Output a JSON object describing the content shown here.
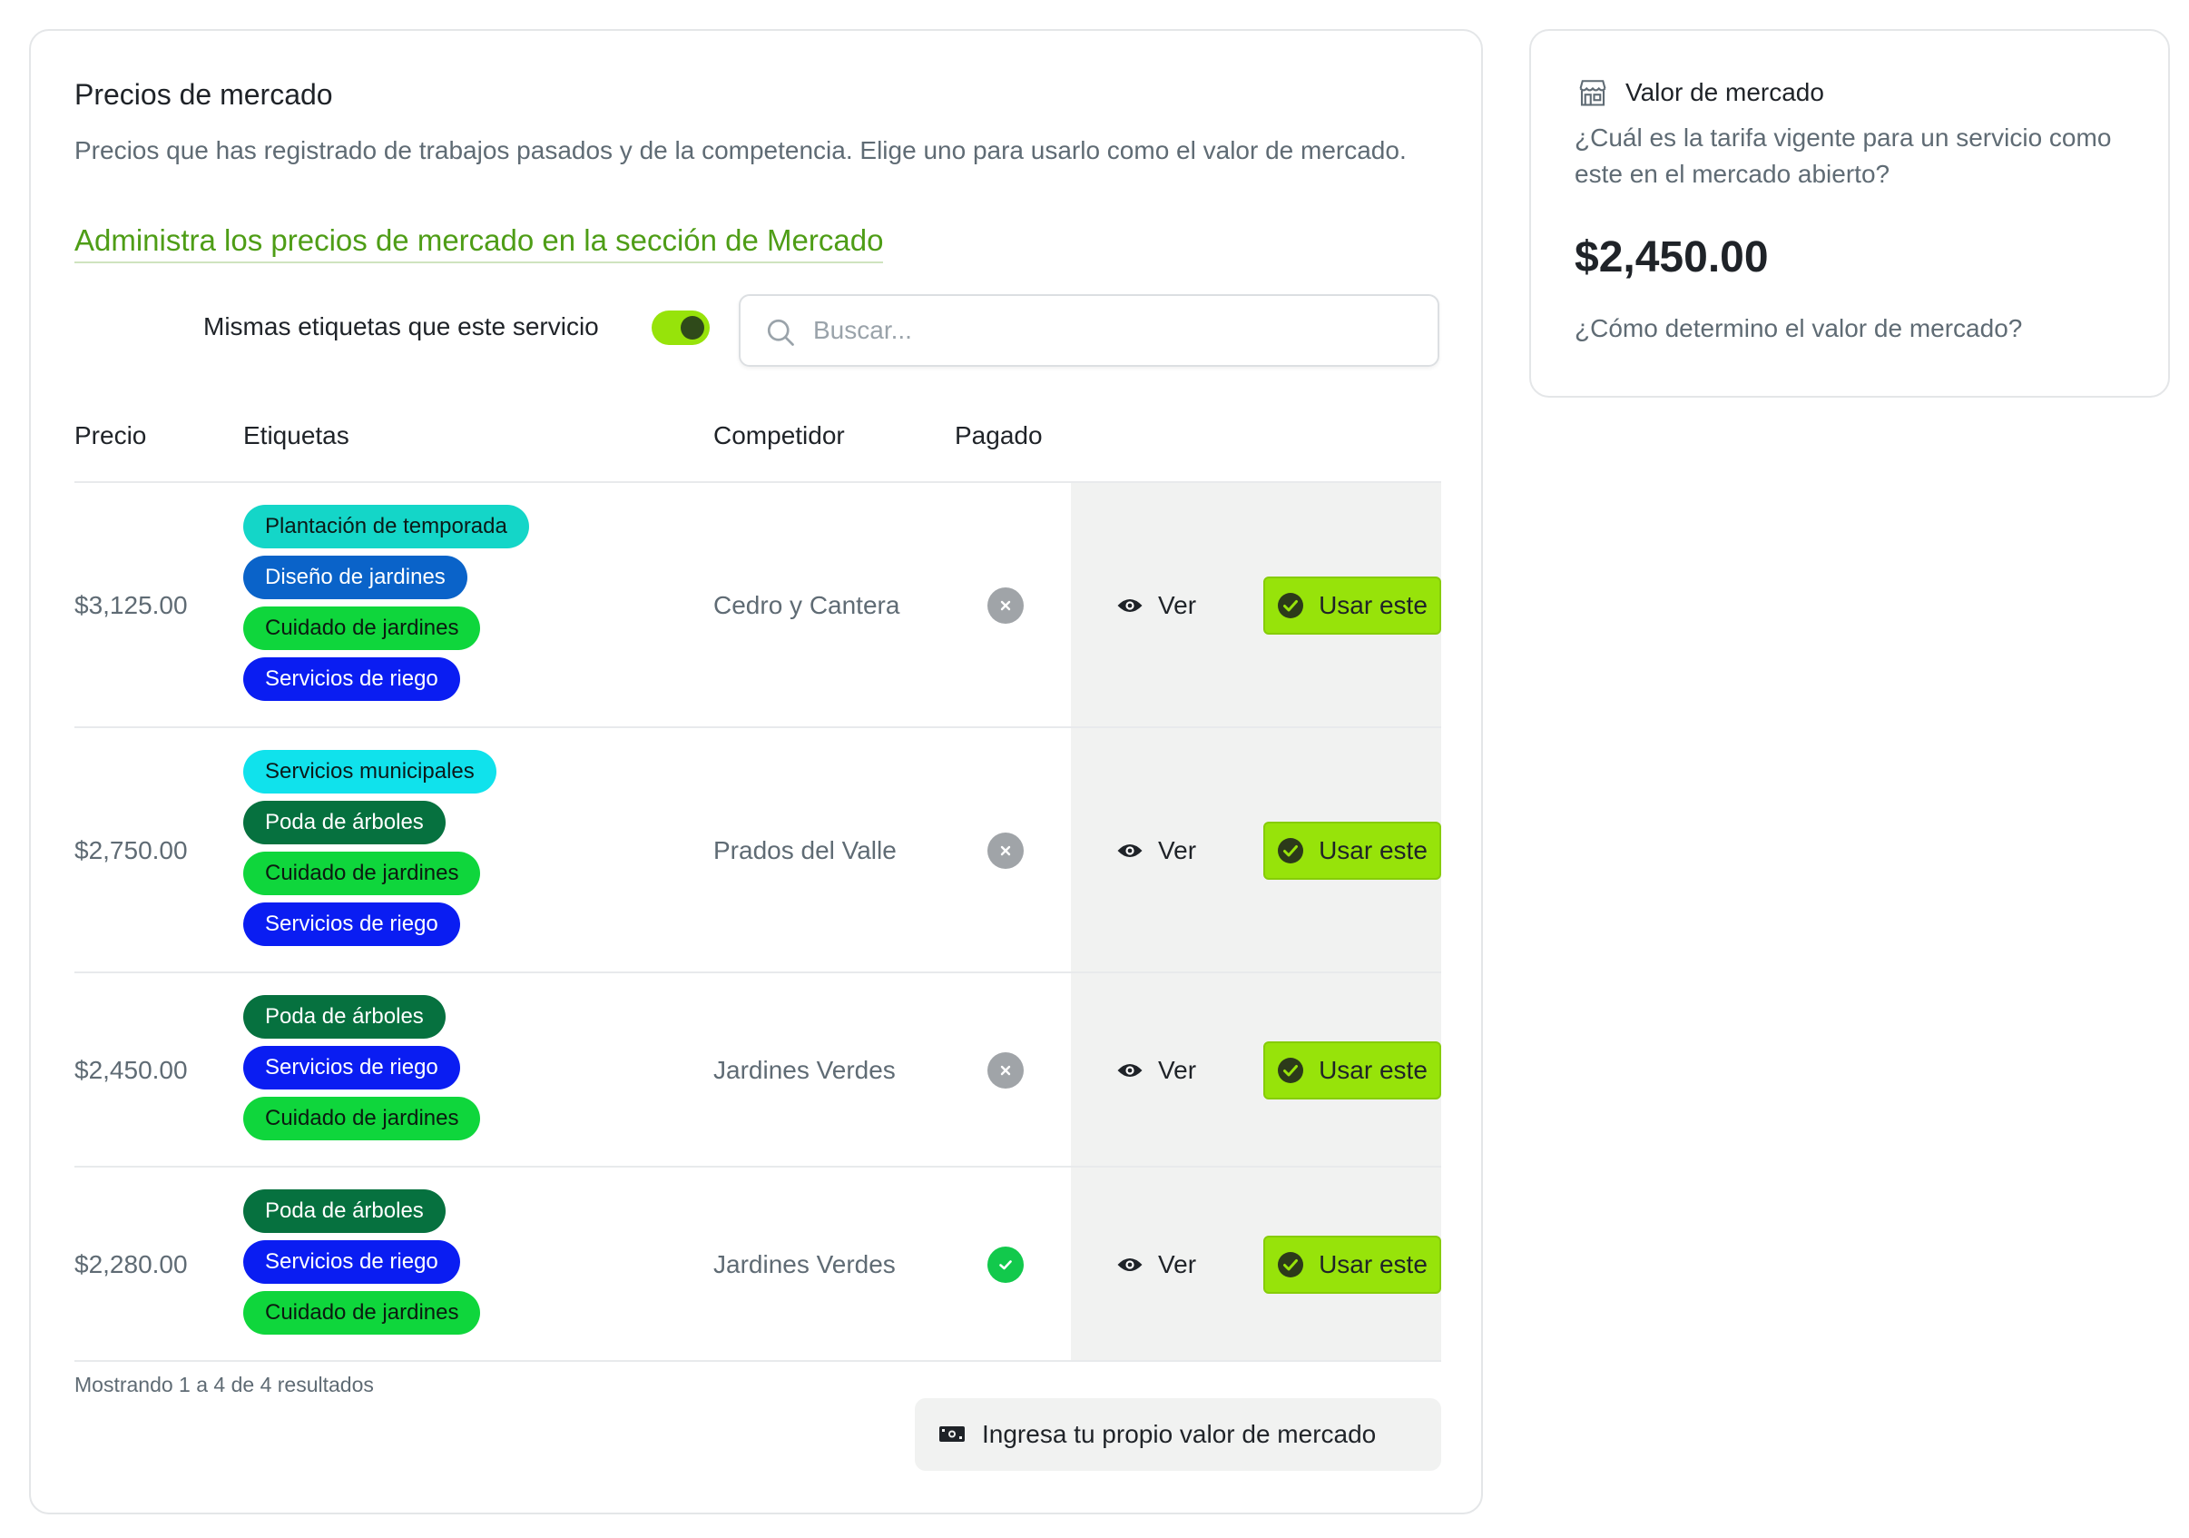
{
  "market_prices": {
    "title": "Precios de mercado",
    "description": "Precios que has registrado de trabajos pasados y de la competencia. Elige uno para usarlo como el valor de mercado.",
    "manage_link": "Administra los precios de mercado en la sección de Mercado",
    "filter": {
      "same_tags_label": "Mismas etiquetas que este servicio",
      "same_tags_enabled": true,
      "search_placeholder": "Buscar..."
    },
    "columns": {
      "price": "Precio",
      "tags": "Etiquetas",
      "competitor": "Competidor",
      "paid": "Pagado"
    },
    "rows": [
      {
        "price": "$3,125.00",
        "tags": [
          "Plantación de temporada",
          "Diseño de jardines",
          "Cuidado de jardines",
          "Servicios de riego"
        ],
        "competitor": "Cedro y Cantera",
        "paid": false,
        "view_label": "Ver",
        "use_label": "Usar este"
      },
      {
        "price": "$2,750.00",
        "tags": [
          "Servicios municipales",
          "Poda de árboles",
          "Cuidado de jardines",
          "Servicios de riego"
        ],
        "competitor": "Prados del Valle",
        "paid": false,
        "view_label": "Ver",
        "use_label": "Usar este"
      },
      {
        "price": "$2,450.00",
        "tags": [
          "Poda de árboles",
          "Servicios de riego",
          "Cuidado de jardines"
        ],
        "competitor": "Jardines Verdes",
        "paid": false,
        "view_label": "Ver",
        "use_label": "Usar este"
      },
      {
        "price": "$2,280.00",
        "tags": [
          "Poda de árboles",
          "Servicios de riego",
          "Cuidado de jardines"
        ],
        "competitor": "Jardines Verdes",
        "paid": true,
        "view_label": "Ver",
        "use_label": "Usar este"
      }
    ],
    "tag_colors": {
      "Plantación de temporada": {
        "bg": "#14d6c8",
        "fg": "#0b1a18"
      },
      "Diseño de jardines": {
        "bg": "#0a63c9",
        "fg": "#ffffff"
      },
      "Cuidado de jardines": {
        "bg": "#0fd63c",
        "fg": "#0b1a10"
      },
      "Servicios de riego": {
        "bg": "#0a1df2",
        "fg": "#ffffff"
      },
      "Servicios municipales": {
        "bg": "#10e2ec",
        "fg": "#0b1a1b"
      },
      "Poda de árboles": {
        "bg": "#06713f",
        "fg": "#ffffff"
      }
    },
    "results_summary": "Mostrando 1 a 4 de 4 resultados",
    "own_value_button": "Ingresa tu propio valor de mercado"
  },
  "market_value": {
    "title": "Valor de mercado",
    "question": "¿Cuál es la tarifa vigente para un servicio como este en el mercado abierto?",
    "value": "$2,450.00",
    "help_link": "¿Cómo determino el valor de mercado?"
  },
  "icons": {
    "search": "search-icon",
    "view": "eye-icon",
    "use": "check-circle-icon",
    "paid_no": "x-icon",
    "paid_yes": "check-icon",
    "own_value": "cash-icon",
    "market_value": "storefront-icon"
  },
  "colors": {
    "accent_green": "#97e30a",
    "link_green": "#4e9d16",
    "paid_yes": "#12c94c",
    "paid_no": "#a0a4a8"
  }
}
